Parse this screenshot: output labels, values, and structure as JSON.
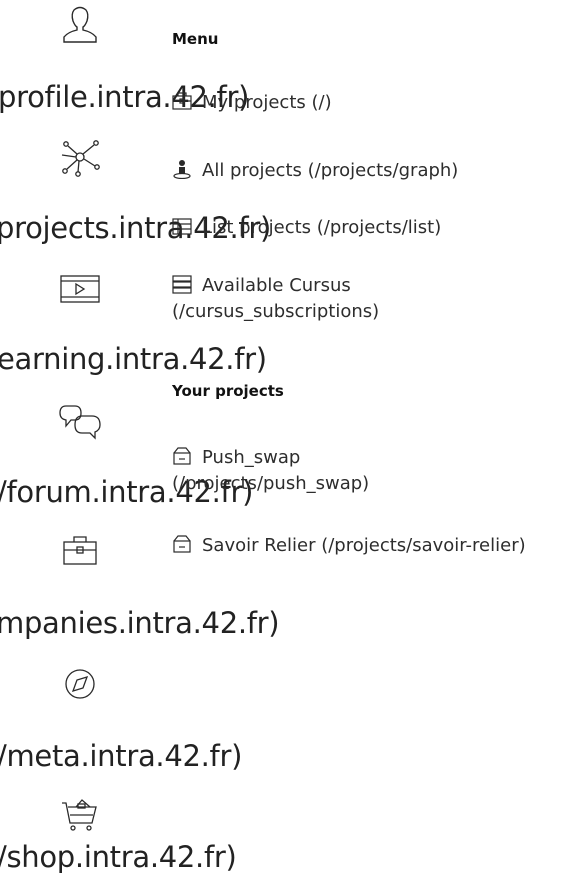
{
  "rail": {
    "items": [
      {
        "icon": "user-icon",
        "url": "profile.intra.42.fr)"
      },
      {
        "icon": "network-icon",
        "url": "projects.intra.42.fr)"
      },
      {
        "icon": "video-icon",
        "url": "earning.intra.42.fr)"
      },
      {
        "icon": "chat-icon",
        "url": "/forum.intra.42.fr)"
      },
      {
        "icon": "briefcase-icon",
        "url": "mpanies.intra.42.fr)"
      },
      {
        "icon": "compass-icon",
        "url": "/meta.intra.42.fr)"
      },
      {
        "icon": "cart-icon",
        "url": "/shop.intra.42.fr)"
      }
    ]
  },
  "menu": {
    "title": "Menu",
    "items": [
      {
        "icon": "folder-icon",
        "label": "My projects (/)"
      },
      {
        "icon": "person-graph-icon",
        "label": "All projects (/projects/graph)"
      },
      {
        "icon": "list-icon",
        "label": "List projects (/projects/list)"
      },
      {
        "icon": "stack-icon",
        "label": "Available Cursus (/cursus_subscriptions)"
      }
    ]
  },
  "your_projects": {
    "title": "Your projects",
    "items": [
      {
        "icon": "box-icon",
        "label": "Push_swap (/projects/push_swap)"
      },
      {
        "icon": "box-icon",
        "label": "Savoir Relier (/projects/savoir-relier)"
      }
    ]
  }
}
